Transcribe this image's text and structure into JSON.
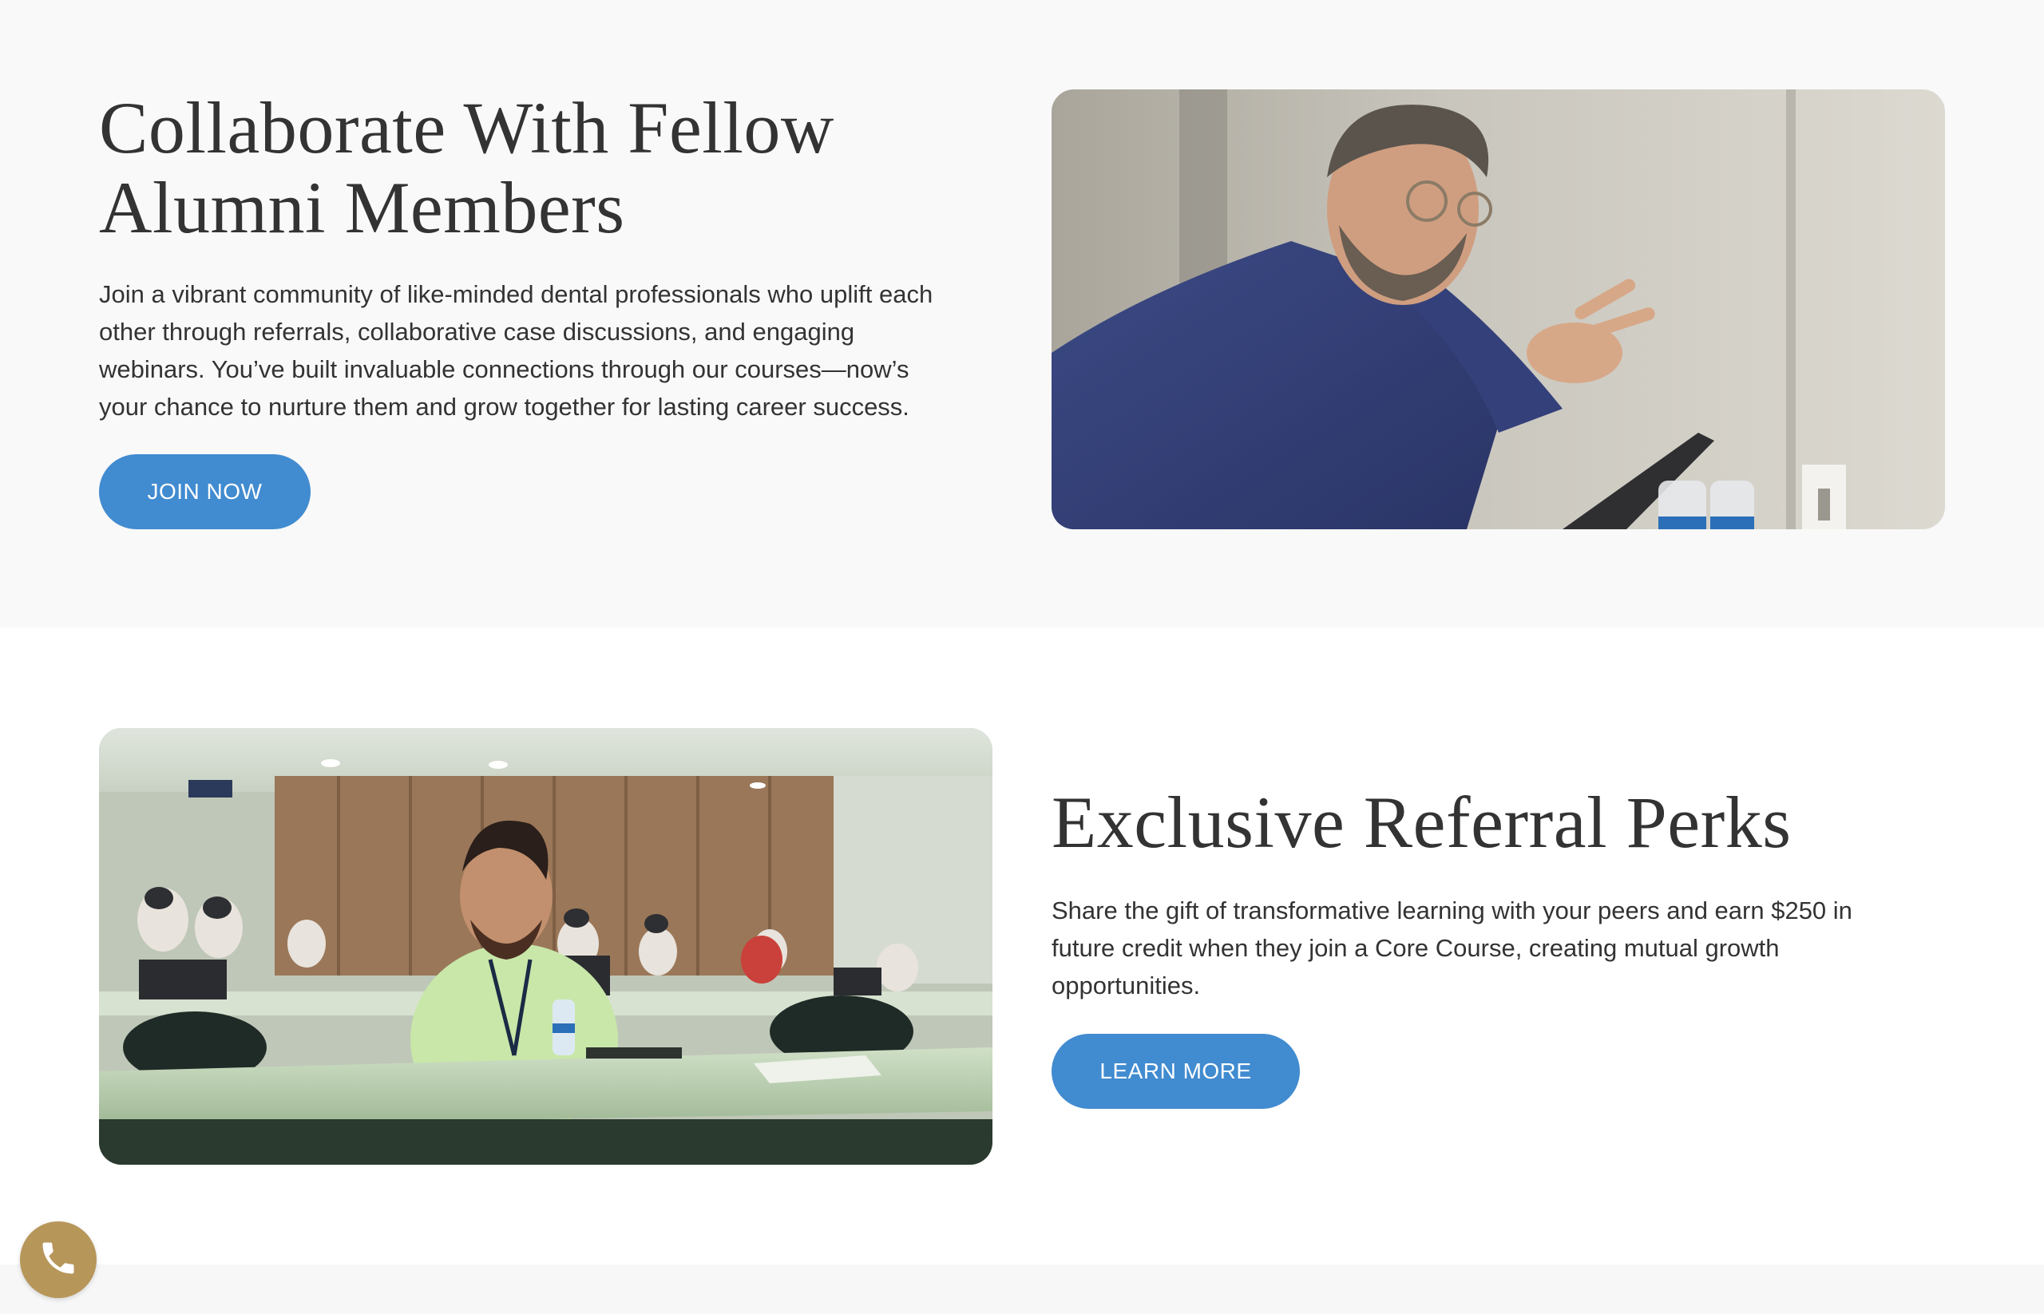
{
  "alumni_section": {
    "title_line1": "Collaborate With Fellow",
    "title_line2": "Alumni Members",
    "body_line1": "Join a vibrant community of like-minded dental professionals who uplift each",
    "body_line2": "other through referrals, collaborative case discussions, and engaging",
    "body_line3": "webinars. You’ve built invaluable connections through our courses—now’s",
    "body_line4": "your chance to nurture them and grow together for lasting career success.",
    "cta_label": "JOIN NOW"
  },
  "referral_section": {
    "title": "Exclusive Referral Perks",
    "body_line1": "Share the gift of transformative learning with your peers and earn $250 in",
    "body_line2": "future credit when they join a Core Course, creating mutual growth",
    "body_line3": "opportunities.",
    "cta_label": "LEARN MORE"
  },
  "floating": {
    "phone_icon": "phone-icon"
  },
  "colors": {
    "accent_blue": "#418bd0",
    "phone_gold": "#b7965a",
    "text": "#333333",
    "top_bg": "#f9f9f9"
  }
}
